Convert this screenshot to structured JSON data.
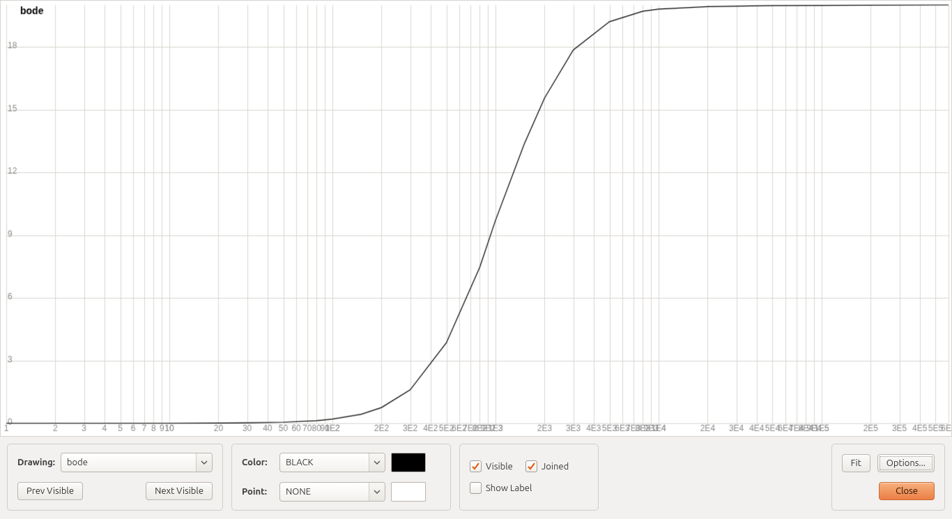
{
  "chart_data": {
    "type": "line",
    "title": "bode",
    "xscale": "log",
    "xlim": [
      1,
      600000
    ],
    "ylim": [
      0,
      20
    ],
    "yticks": [
      0,
      3,
      6,
      9,
      12,
      15,
      18
    ],
    "xticks_per_decade": [
      1,
      2,
      3,
      4,
      5,
      6,
      7,
      8,
      9,
      10
    ],
    "decades": [
      1,
      10,
      100,
      1000,
      10000,
      100000
    ],
    "xlabel": "",
    "ylabel": "",
    "series": [
      {
        "name": "bode",
        "color": "#000000",
        "x": [
          1,
          10,
          30,
          50,
          80,
          100,
          150,
          200,
          300,
          500,
          800,
          1000,
          1500,
          2000,
          3000,
          5000,
          8000,
          10000,
          20000,
          50000,
          100000,
          600000
        ],
        "y": [
          0.0,
          0.0,
          0.02,
          0.05,
          0.12,
          0.2,
          0.43,
          0.75,
          1.6,
          3.85,
          7.45,
          9.7,
          13.35,
          15.55,
          17.85,
          19.2,
          19.7,
          19.8,
          19.92,
          19.97,
          19.98,
          20.0
        ]
      }
    ]
  },
  "controls": {
    "drawing_label": "Drawing:",
    "drawing_value": "bode",
    "prev_visible_label": "Prev Visible",
    "next_visible_label": "Next Visible",
    "color_label": "Color:",
    "color_value": "BLACK",
    "color_hex": "#000000",
    "point_label": "Point:",
    "point_value": "NONE",
    "point_swatch_hex": "#ffffff",
    "visible_label": "Visible",
    "visible_checked": true,
    "joined_label": "Joined",
    "joined_checked": true,
    "show_label_label": "Show Label",
    "show_label_checked": false,
    "fit_label": "Fit",
    "options_label": "Options...",
    "close_label": "Close"
  }
}
